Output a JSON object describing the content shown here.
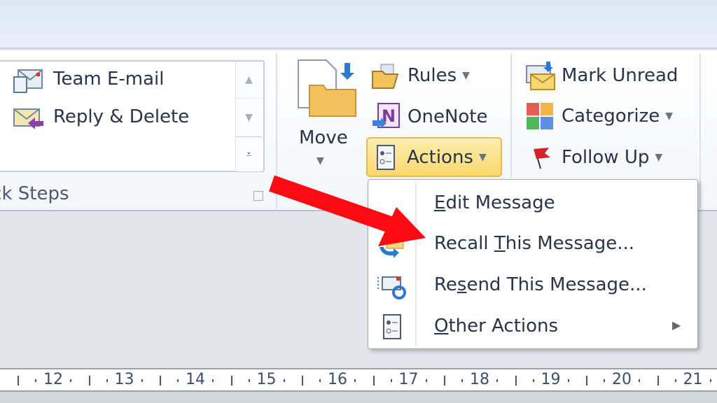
{
  "quick_steps": {
    "group_label": "Quick Steps",
    "items": [
      {
        "label": "Team E-mail",
        "icon": "team-email-icon"
      },
      {
        "label": "Reply & Delete",
        "icon": "reply-delete-icon"
      }
    ]
  },
  "move_group": {
    "move_label": "Move",
    "rules_label": "Rules",
    "onenote_label": "OneNote",
    "actions_label": "Actions"
  },
  "tags_group": {
    "mark_unread_label": "Mark Unread",
    "categorize_label": "Categorize",
    "follow_up_label": "Follow Up"
  },
  "actions_menu": {
    "items": [
      {
        "label": "Edit Message",
        "accelerator": "E"
      },
      {
        "label": "Recall This Message...",
        "accelerator": "T"
      },
      {
        "label": "Resend This Message...",
        "accelerator": "s"
      },
      {
        "label": "Other Actions",
        "accelerator": "O",
        "submenu": true
      }
    ]
  },
  "ruler": {
    "numbers": [
      "12",
      "13",
      "14",
      "15",
      "16",
      "17",
      "18",
      "19",
      "20",
      "21"
    ]
  },
  "colors": {
    "highlight": "#fbd86b",
    "annotation_arrow": "#ff0000"
  }
}
